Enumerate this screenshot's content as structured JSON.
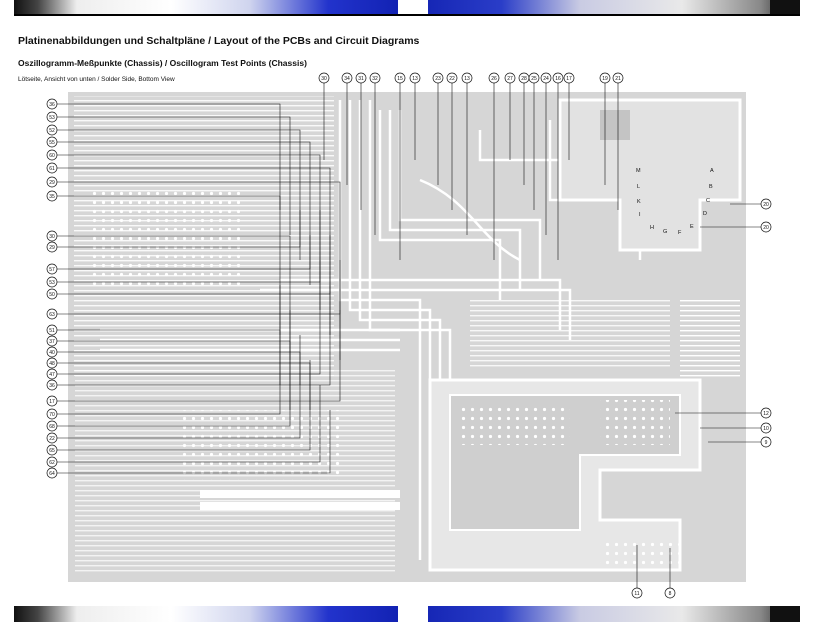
{
  "header": {
    "title": "Platinenabbildungen und Schaltpläne / Layout of the PCBs and Circuit Diagrams",
    "subtitle": "Oszillogramm-Meßpunkte (Chassis) / Oscillogram Test Points (Chassis)",
    "caption": "Lötseite, Ansicht von unten / Solder Side, Bottom View"
  },
  "left_test_points": [
    "36",
    "53",
    "52",
    "55",
    "60",
    "61",
    "29",
    "35",
    "30",
    "29",
    "57",
    "53",
    "50",
    "63",
    "51",
    "37",
    "40",
    "48",
    "47",
    "36",
    "17",
    "70",
    "68",
    "22",
    "65",
    "62",
    "64"
  ],
  "top_test_points": [
    "30",
    "34",
    "31",
    "32",
    "15",
    "13",
    "23",
    "22",
    "13",
    "26",
    "27",
    "28",
    "25",
    "24",
    "16",
    "17",
    "19",
    "21"
  ],
  "right_test_points": [
    "20",
    "20",
    "12",
    "10",
    "9"
  ],
  "bottom_test_points": [
    "11",
    "8"
  ],
  "connector_letters": [
    "M",
    "L",
    "K",
    "I",
    "H",
    "G",
    "F",
    "E",
    "D",
    "C",
    "B",
    "A"
  ],
  "colors": {
    "board": "#d9d9d9",
    "trace": "#ffffff",
    "leader": "#111111",
    "accent_blue": "#1020b0"
  }
}
